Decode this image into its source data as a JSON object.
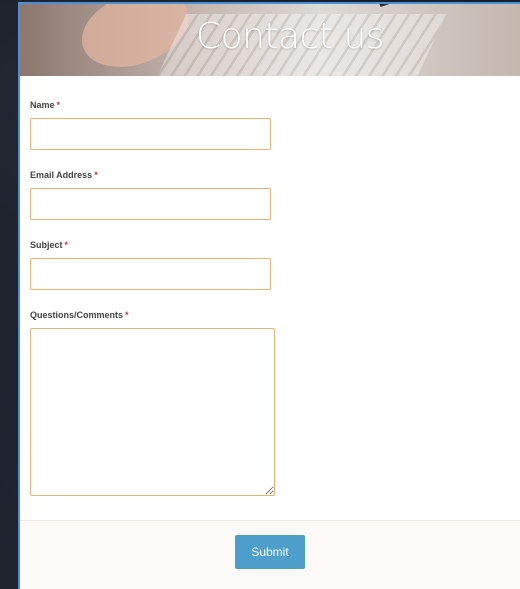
{
  "hero": {
    "title": "Contact us"
  },
  "form": {
    "required_marker": "*",
    "fields": [
      {
        "label": "Name",
        "value": "",
        "placeholder": ""
      },
      {
        "label": "Email Address",
        "value": "",
        "placeholder": ""
      },
      {
        "label": "Subject",
        "value": "",
        "placeholder": ""
      },
      {
        "label": "Questions/Comments",
        "value": "",
        "placeholder": ""
      }
    ],
    "submit_label": "Submit"
  },
  "colors": {
    "frame_border": "#4a90d9",
    "input_border": "#e2b47a",
    "required": "#d0343a",
    "submit_bg": "#4d9ecb"
  }
}
